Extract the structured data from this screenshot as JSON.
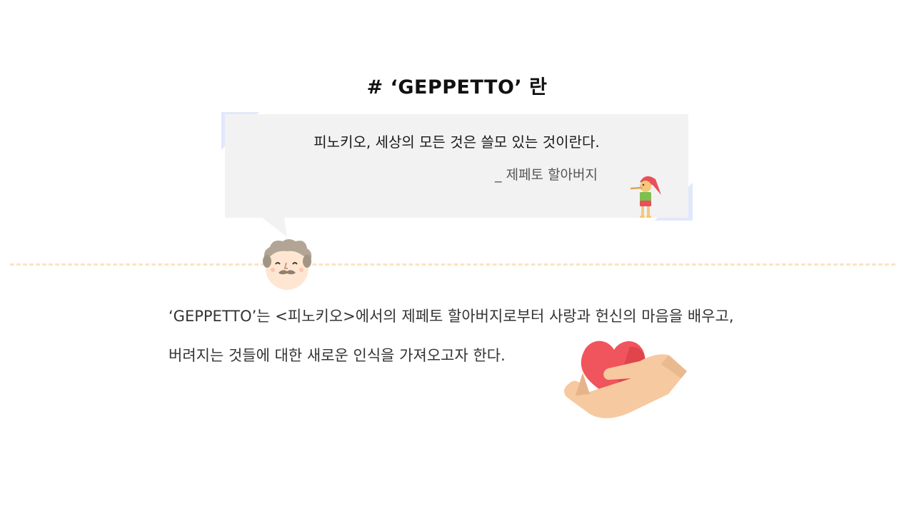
{
  "title": "# ‘GEPPETTO’ 란",
  "quote": {
    "text": "피노키오, 세상의 모든 것은 쓸모 있는 것이란다.",
    "author": "_  제페토 할아버지"
  },
  "description": {
    "line1": "‘GEPPETTO’는 <피노키오>에서의 제페토 할아버지로부터 사랑과 헌신의 마음을 배우고,",
    "line2": "버려지는 것들에 대한 새로운 인식을 가져오고자 한다."
  },
  "colors": {
    "quote_bg": "#f2f2f2",
    "corner_accent": "#e2e8fb",
    "dash": "#fbe3c4",
    "heart": "#f0545c",
    "hand": "#f6c9a0"
  },
  "icons": [
    "geppetto-face-icon",
    "pinocchio-icon",
    "heart-in-hand-icon"
  ]
}
